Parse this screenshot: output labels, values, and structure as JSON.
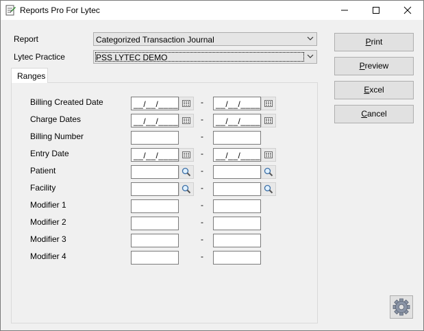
{
  "window": {
    "title": "Reports Pro For Lytec",
    "minimize_glyph": "—",
    "maximize_glyph": "☐",
    "close_glyph": "✕"
  },
  "form": {
    "report_label": "Report",
    "report_value": "Categorized Transaction Journal",
    "practice_label": "Lytec Practice",
    "practice_value": "PSS LYTEC DEMO"
  },
  "tabs": [
    {
      "label": "Ranges"
    }
  ],
  "ranges": {
    "separator": "-",
    "date_mask": "__/__/____",
    "rows": [
      {
        "label": "Billing Created Date",
        "kind": "date",
        "from": "",
        "to": ""
      },
      {
        "label": "Charge Dates",
        "kind": "date",
        "from": "",
        "to": ""
      },
      {
        "label": "Billing Number",
        "kind": "text",
        "from": "",
        "to": ""
      },
      {
        "label": "Entry Date",
        "kind": "date",
        "from": "",
        "to": ""
      },
      {
        "label": "Patient",
        "kind": "lookup",
        "from": "",
        "to": ""
      },
      {
        "label": "Facility",
        "kind": "lookup",
        "from": "",
        "to": ""
      },
      {
        "label": "Modifier 1",
        "kind": "text",
        "from": "",
        "to": ""
      },
      {
        "label": "Modifier 2",
        "kind": "text",
        "from": "",
        "to": ""
      },
      {
        "label": "Modifier 3",
        "kind": "text",
        "from": "",
        "to": ""
      },
      {
        "label": "Modifier 4",
        "kind": "text",
        "from": "",
        "to": ""
      }
    ]
  },
  "buttons": {
    "print": {
      "label_pre": "",
      "accel": "P",
      "label_post": "rint"
    },
    "preview": {
      "label_pre": "",
      "accel": "P",
      "label_post": "review"
    },
    "excel": {
      "label_pre": "",
      "accel": "E",
      "label_post": "xcel"
    },
    "cancel": {
      "label_pre": "",
      "accel": "C",
      "label_post": "ancel"
    }
  },
  "icons": {
    "app": "report-app-icon",
    "calendar": "calendar-icon",
    "lookup": "magnifier-icon",
    "settings": "gear-icon",
    "dropdown": "chevron-down-icon"
  }
}
